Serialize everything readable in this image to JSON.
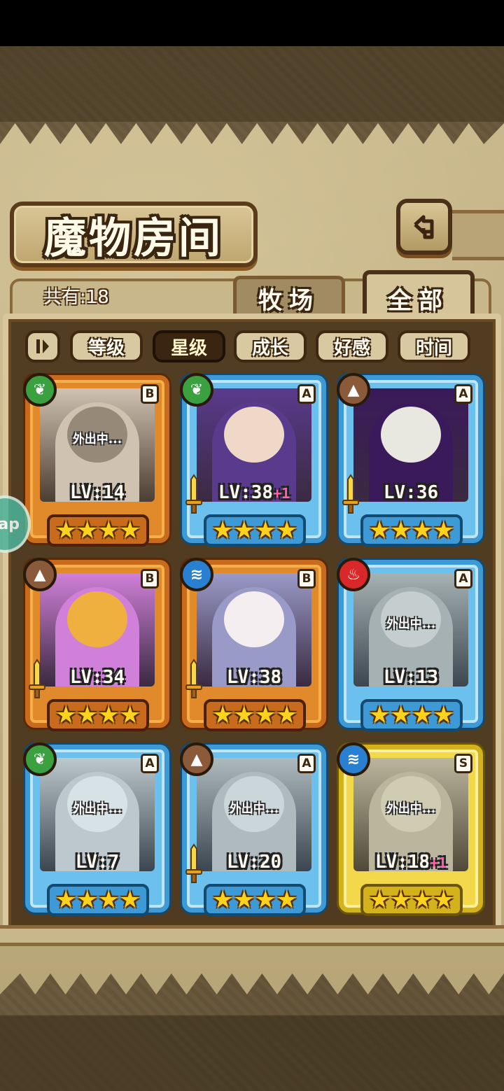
{
  "page": {
    "title": "魔物房间"
  },
  "count_label": "共有:18",
  "tabs": [
    {
      "label": "牧场"
    },
    {
      "label": "全部"
    }
  ],
  "sort": {
    "toggle_icon": "sort-toggle-icon",
    "options": [
      {
        "label": "等级"
      },
      {
        "label": "星级"
      },
      {
        "label": "成长"
      },
      {
        "label": "好感"
      },
      {
        "label": "时间"
      }
    ],
    "active_index": 1
  },
  "side_bubble": {
    "label": "ap"
  },
  "monsters": [
    {
      "level": "LV:14",
      "plus": "",
      "rank": "B",
      "element": "leaf",
      "weapon": false,
      "away": true,
      "away_text": "外出中...",
      "stars": 4,
      "colors": [
        "#c9c2b0",
        "#8c8270"
      ]
    },
    {
      "level": "LV:38",
      "plus": "+1",
      "rank": "A",
      "element": "leaf",
      "weapon": true,
      "away": false,
      "away_text": "",
      "stars": 4,
      "colors": [
        "#5a3a8c",
        "#f0d8c8"
      ]
    },
    {
      "level": "LV:36",
      "plus": "",
      "rank": "A",
      "element": "earth",
      "weapon": true,
      "away": false,
      "away_text": "",
      "stars": 4,
      "colors": [
        "#3a1a5a",
        "#e8e8e0"
      ]
    },
    {
      "level": "LV:34",
      "plus": "",
      "rank": "B",
      "element": "earth",
      "weapon": true,
      "away": false,
      "away_text": "",
      "stars": 4,
      "colors": [
        "#d080d8",
        "#f0b040"
      ]
    },
    {
      "level": "LV:38",
      "plus": "",
      "rank": "B",
      "element": "water",
      "weapon": true,
      "away": false,
      "away_text": "",
      "stars": 4,
      "colors": [
        "#9a9ac8",
        "#f4eef0"
      ]
    },
    {
      "level": "LV:13",
      "plus": "",
      "rank": "A",
      "element": "fire",
      "weapon": false,
      "away": true,
      "away_text": "外出中...",
      "stars": 4,
      "colors": [
        "#b0a880",
        "#d8c890"
      ]
    },
    {
      "level": "LV:7",
      "plus": "",
      "rank": "A",
      "element": "leaf",
      "weapon": false,
      "away": true,
      "away_text": "外出中...",
      "stars": 4,
      "colors": [
        "#c8c0b0",
        "#e8dccb"
      ]
    },
    {
      "level": "LV:20",
      "plus": "",
      "rank": "A",
      "element": "earth",
      "weapon": true,
      "away": true,
      "away_text": "外出中...",
      "stars": 4,
      "colors": [
        "#b8b0a0",
        "#d8cfc0"
      ]
    },
    {
      "level": "LV:18",
      "plus": "+1",
      "rank": "S",
      "element": "water",
      "weapon": false,
      "away": true,
      "away_text": "外出中...",
      "stars": 4,
      "colors": [
        "#b0a890",
        "#c8c0a8"
      ]
    }
  ],
  "element_icons": {
    "leaf": "leaf-icon",
    "earth": "mountain-icon",
    "water": "water-wave-icon",
    "fire": "flame-icon"
  },
  "colors": {
    "rank_B": "#c86b1c",
    "rank_A": "#3e9ad6",
    "rank_S": "#d4b21c",
    "star": "#ffd21e",
    "level_plus": "#ff5fae"
  }
}
